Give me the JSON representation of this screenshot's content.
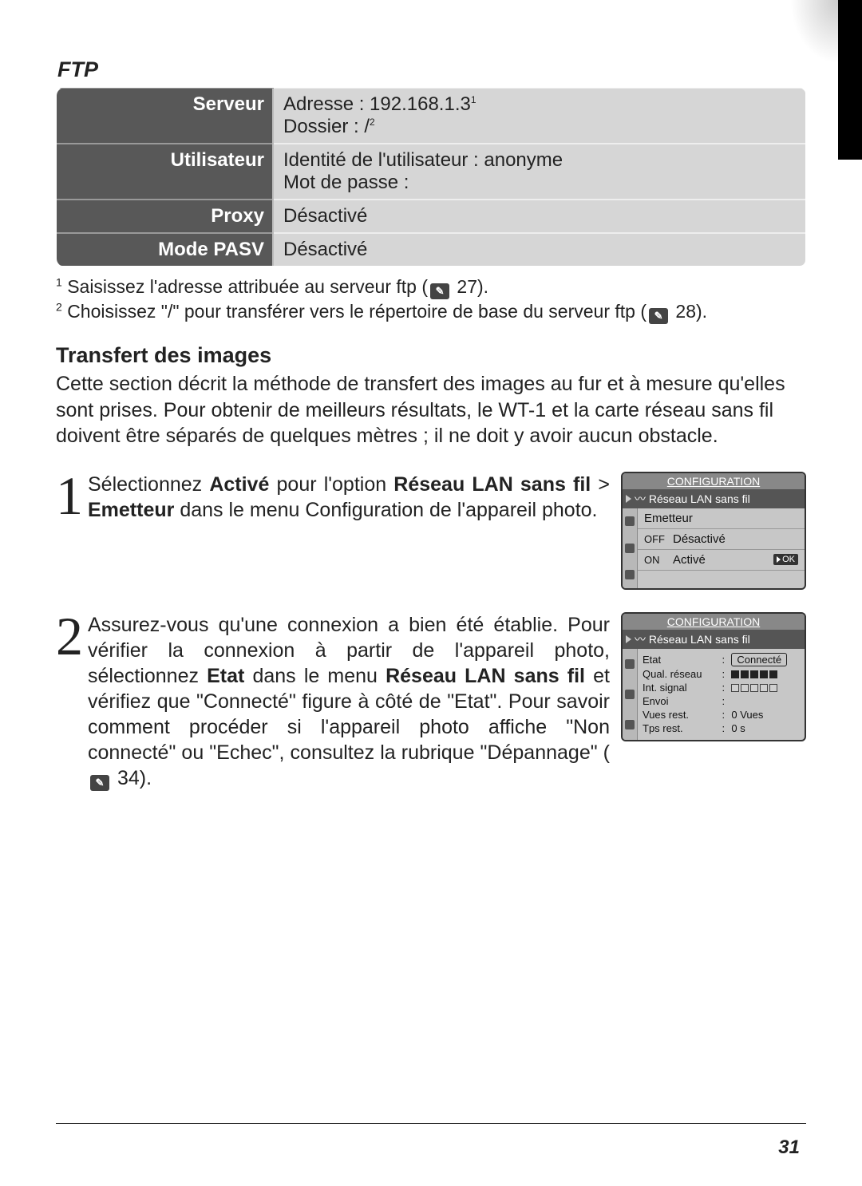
{
  "ftp_heading": "FTP",
  "table": {
    "serveur_label": "Serveur",
    "serveur_line1": "Adresse : 192.168.1.3",
    "serveur_line1_sup": "1",
    "serveur_line2": "Dossier : /",
    "serveur_line2_sup": "2",
    "user_label": "Utilisateur",
    "user_line1": "Identité de l'utilisateur : anonyme",
    "user_line2": "Mot de passe :",
    "proxy_label": "Proxy",
    "proxy_val": "Désactivé",
    "pasv_label": "Mode PASV",
    "pasv_val": "Désactivé"
  },
  "footnotes": {
    "f1_sup": "1",
    "f1_text": "Saisissez l'adresse attribuée au serveur ftp (",
    "f1_ref": "27).",
    "f2_sup": "2",
    "f2_text": "Choisissez \"/\" pour transférer vers le répertoire de base du serveur ftp (",
    "f2_ref": "28)."
  },
  "section_heading": "Transfert des images",
  "intro": "Cette section décrit la méthode de transfert des images au fur et à mesure qu'elles sont prises. Pour obtenir de meilleurs résultats, le WT-1 et la carte réseau sans fil doivent être séparés de quelques mètres ; il ne doit y avoir aucun obstacle.",
  "step1": {
    "num": "1",
    "t1": "Sélectionnez ",
    "b1": "Activé",
    "t2": " pour l'option ",
    "b2": "Réseau LAN sans fil",
    "t3": " > ",
    "b3": "Emetteur",
    "t4": " dans le menu Configuration de l'appareil photo."
  },
  "camera1": {
    "title": "CONFIGURATION",
    "sub": "Réseau LAN sans fil",
    "row_header": "Emetteur",
    "off_code": "OFF",
    "off_label": "Désactivé",
    "on_code": "ON",
    "on_label": "Activé",
    "ok": "OK"
  },
  "step2": {
    "num": "2",
    "t1": "Assurez-vous qu'une connexion a bien été établie. Pour vérifier la connexion à partir de l'appareil photo, sélectionnez ",
    "b1": "Etat",
    "t2": " dans le menu ",
    "b2": "Réseau LAN sans fil",
    "t3": " et vérifiez que \"Connecté\" figure à côté de \"Etat\". Pour savoir comment procéder si l'appareil photo affiche \"Non connecté\" ou \"Echec\", consultez la rubrique \"Dépannage\" (",
    "ref": "34)."
  },
  "camera2": {
    "title": "CONFIGURATION",
    "sub": "Réseau LAN sans fil",
    "rows": {
      "etat_l": "Etat",
      "etat_v": "Connecté",
      "qual_l": "Qual. réseau",
      "sig_l": "Int. signal",
      "env_l": "Envoi",
      "vues_l": "Vues rest.",
      "vues_v": "0 Vues",
      "tps_l": "Tps rest.",
      "tps_v": "0 s"
    }
  },
  "page_number": "31"
}
